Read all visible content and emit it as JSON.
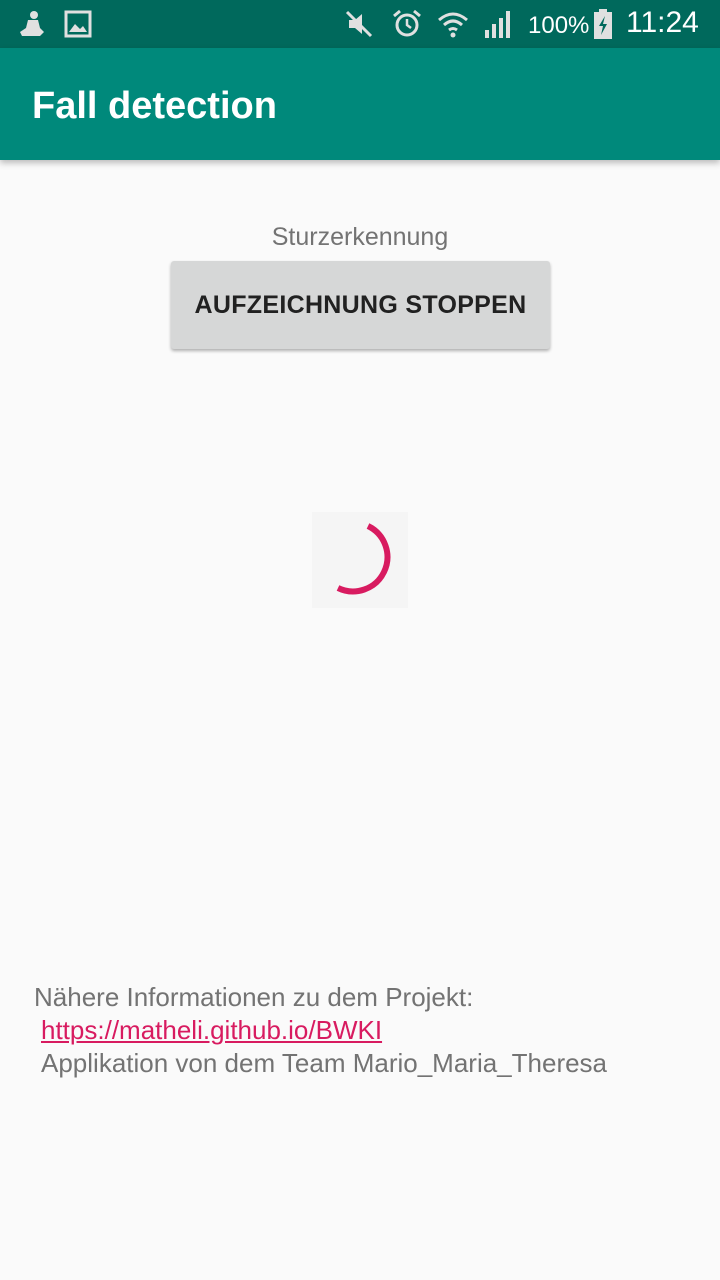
{
  "status_bar": {
    "battery_percent": "100%",
    "time": "11:24",
    "icons": [
      "notification-app-icon",
      "gallery-icon",
      "mute-icon",
      "alarm-icon",
      "wifi-icon",
      "signal-icon",
      "battery-charging-icon"
    ]
  },
  "app_bar": {
    "title": "Fall detection"
  },
  "main": {
    "subtitle": "Sturzerkennung",
    "stop_button_label": "AUFZEICHNUNG STOPPEN",
    "spinner_color": "#d81b60"
  },
  "footer": {
    "info_label": "Nähere Informationen zu dem Projekt:",
    "link": "https://matheli.github.io/BWKI",
    "credits": "Applikation von dem Team Mario_Maria_Theresa"
  },
  "colors": {
    "status_bar": "#00695c",
    "app_bar": "#00897b",
    "accent": "#d81b60",
    "button": "#d6d7d7"
  }
}
